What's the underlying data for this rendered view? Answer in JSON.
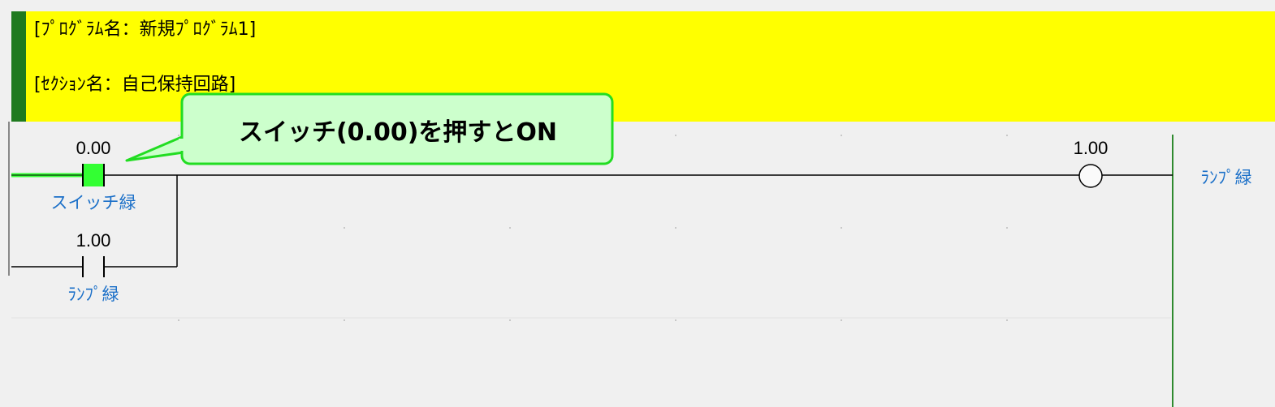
{
  "program_comment": "[ﾌﾟﾛｸﾞﾗﾑ名：新規ﾌﾟﾛｸﾞﾗﾑ1]",
  "section_comment": "[ｾｸｼｮﾝ名：自己保持回路]",
  "callout": "スイッチ(0.00)を押すとON",
  "rung": {
    "contact_switch": {
      "address": "0.00",
      "symbol": "スイッチ緑",
      "state": "ON"
    },
    "contact_lamp": {
      "address": "1.00",
      "symbol": "ﾗﾝﾌﾟ緑"
    },
    "coil_lamp": {
      "address": "1.00",
      "symbol": "ﾗﾝﾌﾟ緑"
    }
  },
  "colors": {
    "comment_bg": "#ffff00",
    "comment_bar": "#1f7a1f",
    "active": "#33ff33",
    "symbol_text": "#1a6fc8",
    "callout_bg": "#ccffcc",
    "callout_border": "#22dd22"
  }
}
